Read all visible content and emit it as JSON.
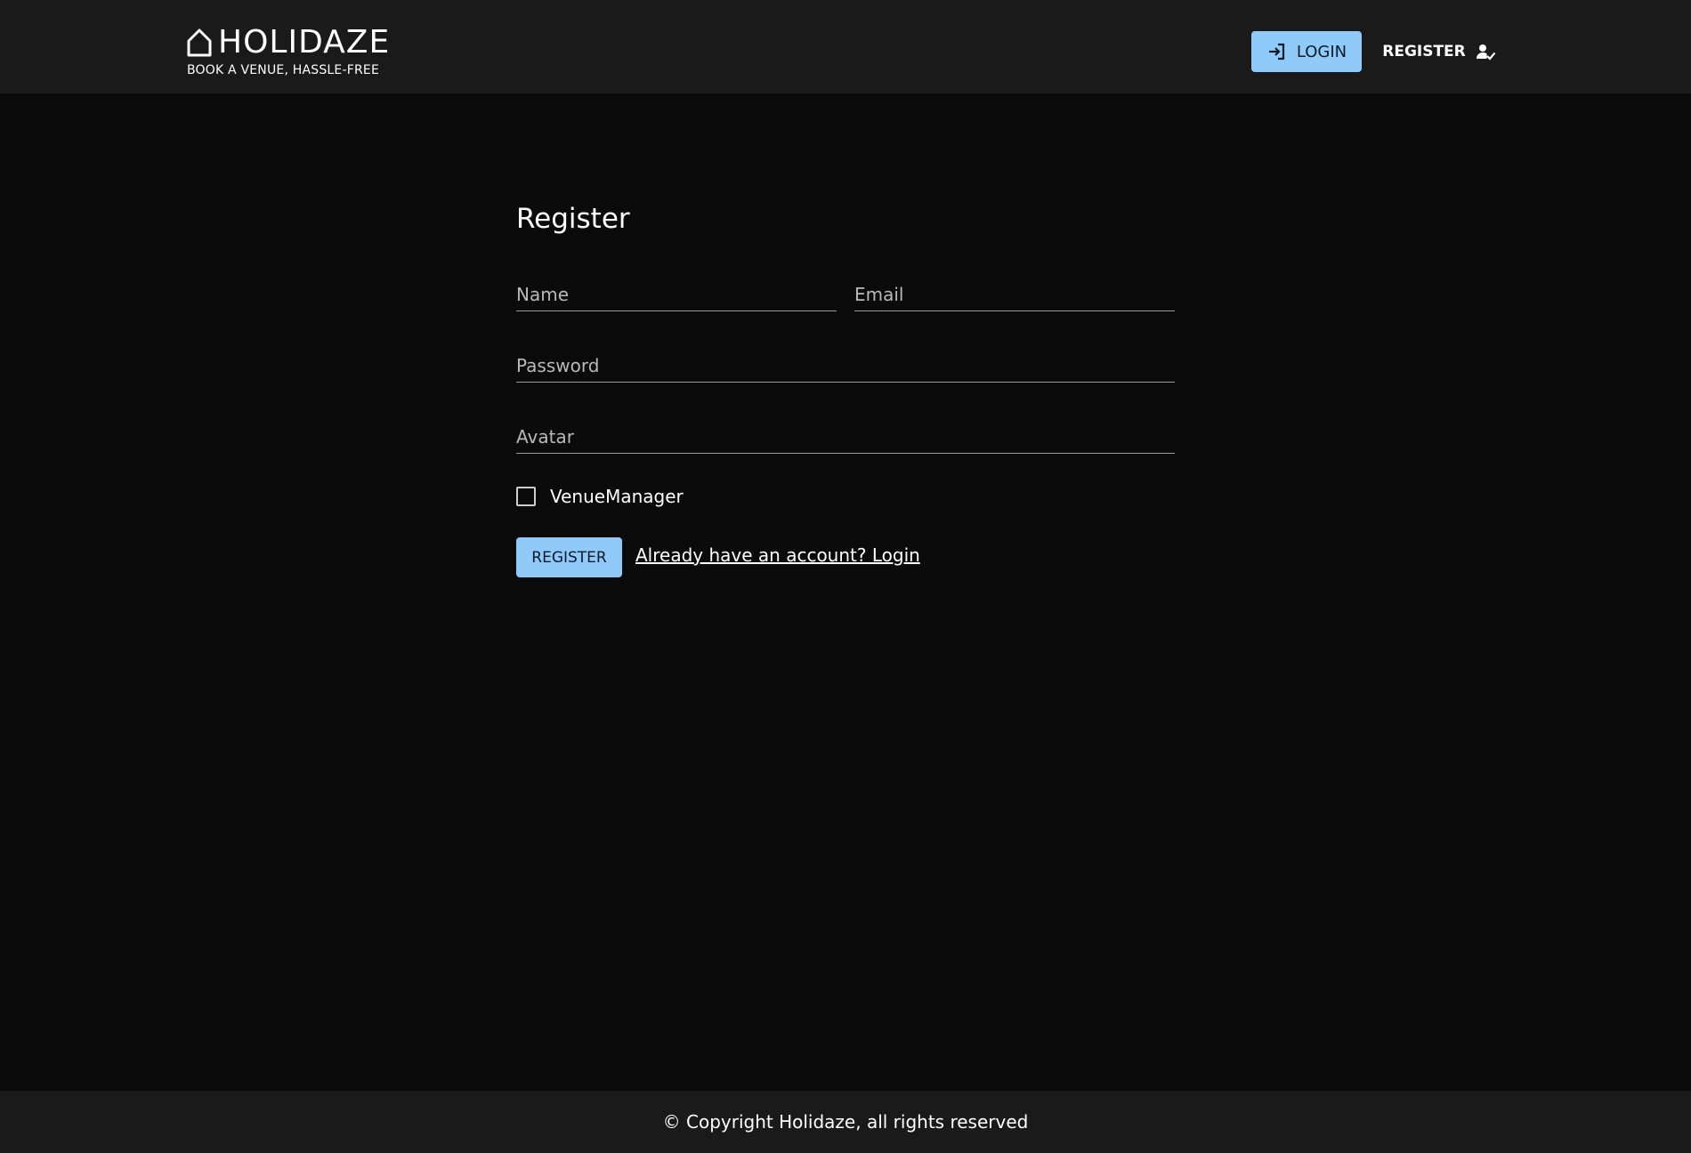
{
  "header": {
    "brand": {
      "title": "HOLIDAZE",
      "tagline": "BOOK A VENUE, HASSLE-FREE",
      "icon": "house-icon"
    },
    "nav": {
      "login_label": "LOGIN",
      "login_icon": "login-icon",
      "register_label": "REGISTER",
      "register_icon": "person-check-icon"
    }
  },
  "form": {
    "title": "Register",
    "fields": {
      "name": {
        "placeholder": "Name",
        "value": ""
      },
      "email": {
        "placeholder": "Email",
        "value": ""
      },
      "password": {
        "placeholder": "Password",
        "value": ""
      },
      "avatar": {
        "placeholder": "Avatar",
        "value": ""
      }
    },
    "venue_manager": {
      "label": "VenueManager",
      "checked": false
    },
    "submit_label": "REGISTER",
    "login_link": "Already have an account? Login"
  },
  "footer": {
    "copyright": "© Copyright Holidaze, all rights reserved"
  },
  "colors": {
    "background": "#0b0b0c",
    "header_bg": "#1a1a1b",
    "accent": "#90caf9"
  }
}
